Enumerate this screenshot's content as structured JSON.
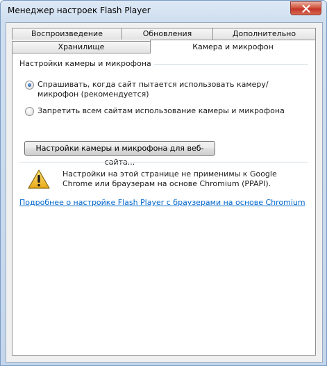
{
  "window": {
    "title": "Менеджер настроек Flash Player"
  },
  "tabs": {
    "row_top": [
      {
        "label": "Воспроизведение"
      },
      {
        "label": "Обновления"
      },
      {
        "label": "Дополнительно"
      }
    ],
    "row_bottom": [
      {
        "label": "Хранилище"
      },
      {
        "label": "Камера и микрофон"
      }
    ],
    "active": "Камера и микрофон"
  },
  "camera_panel": {
    "group_title": "Настройки камеры и микрофона",
    "options": [
      {
        "label": "Спрашивать, когда сайт пытается использовать камеру/микрофон (рекомендуется)",
        "checked": true
      },
      {
        "label": "Запретить всем сайтам использование камеры и микрофона",
        "checked": false
      }
    ],
    "site_settings_button": "Настройки камеры и микрофона для веб-сайта...",
    "warning_text": "Настройки на этой странице не применимы к Google Chrome или браузерам на основе Chromium (PPAPI).",
    "link_text": "Подробнее о настройке Flash Player с браузерами на основе Chromium"
  },
  "icons": {
    "close": "close-icon",
    "warning": "warning-icon"
  },
  "colors": {
    "link": "#0066cc",
    "close_button": "#c4352a",
    "warning": "#f2c230"
  }
}
